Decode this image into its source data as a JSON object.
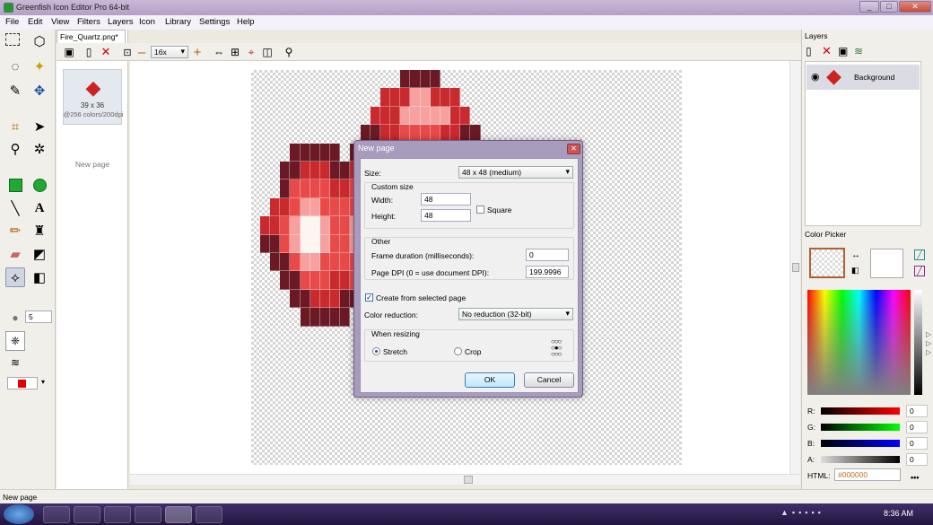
{
  "window": {
    "title": "Greenfish Icon Editor Pro 64-bit",
    "buttons": [
      "_",
      "□",
      "✕"
    ]
  },
  "menu": [
    "File",
    "Edit",
    "View",
    "Filters",
    "Layers",
    "Icon",
    "Library",
    "Settings",
    "Help"
  ],
  "document_tab": "Fire_Quartz.png*",
  "pages_panel": {
    "thumb_size": "39 x 36",
    "thumb_info": "@256 colors/200dpi",
    "new_page": "New page"
  },
  "toolbar": {
    "zoom": "16x"
  },
  "toolbox": {
    "brush_size": "5",
    "color_accent": "#e00000"
  },
  "layers": {
    "header": "Layers",
    "layer_name": "Background"
  },
  "color_picker": {
    "header": "Color Picker",
    "channels": [
      {
        "label": "R:",
        "value": "0"
      },
      {
        "label": "G:",
        "value": "0"
      },
      {
        "label": "B:",
        "value": "0"
      },
      {
        "label": "A:",
        "value": "0"
      }
    ],
    "html_label": "HTML:",
    "html_value": "#000000",
    "more": "•••"
  },
  "status": "New page",
  "clock": "8:36 AM",
  "dialog": {
    "title": "New page",
    "size_label": "Size:",
    "size_value": "48 x 48 (medium)",
    "custom_size": "Custom size",
    "width_label": "Width:",
    "width_value": "48",
    "height_label": "Height:",
    "height_value": "48",
    "square_label": "Square",
    "other": "Other",
    "frame_label": "Frame duration (milliseconds):",
    "frame_value": "0",
    "dpi_label": "Page DPI (0 = use document DPI):",
    "dpi_value": "199.9996",
    "create_label": "Create from selected page",
    "color_reduction_label": "Color reduction:",
    "color_reduction_value": "No reduction (32-bit)",
    "resizing": "When resizing",
    "stretch": "Stretch",
    "crop": "Crop",
    "ok": "OK",
    "cancel": "Cancel"
  }
}
